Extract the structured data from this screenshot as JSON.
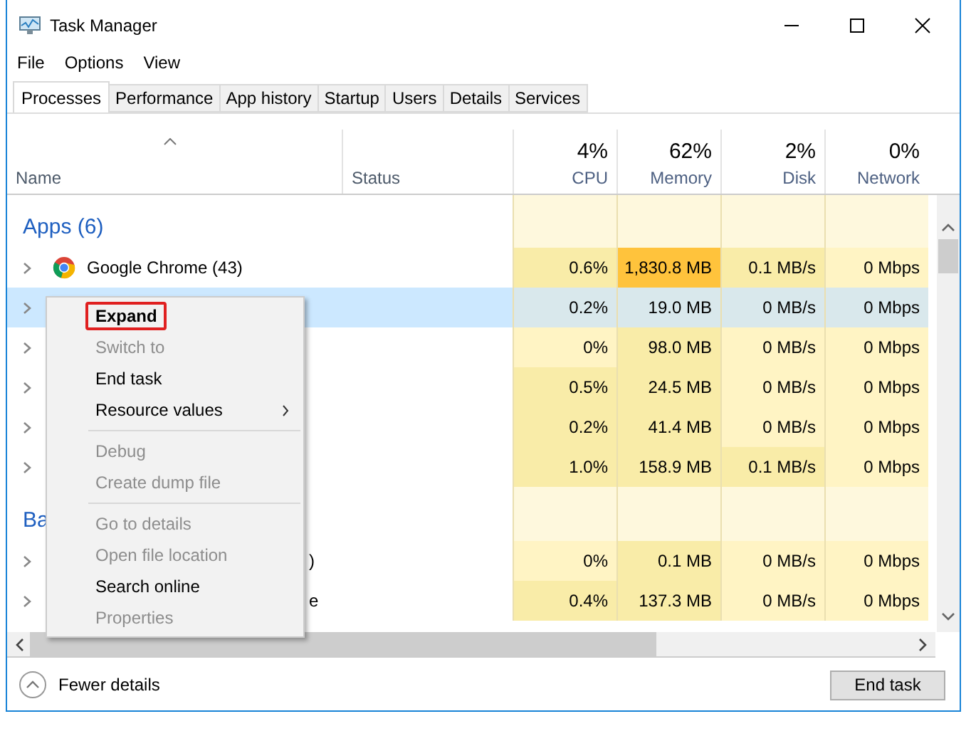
{
  "window": {
    "title": "Task Manager"
  },
  "menu": [
    "File",
    "Options",
    "View"
  ],
  "tabs": [
    {
      "label": "Processes",
      "selected": true
    },
    {
      "label": "Performance",
      "selected": false
    },
    {
      "label": "App history",
      "selected": false
    },
    {
      "label": "Startup",
      "selected": false
    },
    {
      "label": "Users",
      "selected": false
    },
    {
      "label": "Details",
      "selected": false
    },
    {
      "label": "Services",
      "selected": false
    }
  ],
  "columns": [
    {
      "label": "Name",
      "sorted": true
    },
    {
      "label": "Status"
    },
    {
      "label": "CPU",
      "total": "4%"
    },
    {
      "label": "Memory",
      "total": "62%"
    },
    {
      "label": "Disk",
      "total": "2%"
    },
    {
      "label": "Network",
      "total": "0%"
    }
  ],
  "rows": [
    {
      "kind": "group",
      "name": "Apps (6)"
    },
    {
      "kind": "browser",
      "name": "Google Chrome (43)",
      "selected": false,
      "cells": [
        {
          "text": "0.6%",
          "color": "#f9eca8"
        },
        {
          "text": "1,830.8 MB",
          "color": "#ffc33c"
        },
        {
          "text": "0.1 MB/s",
          "color": "#f9eca8"
        },
        {
          "text": "0 Mbps",
          "color": "#fff4c4"
        }
      ]
    },
    {
      "kind": "process",
      "selected": true,
      "cells": [
        {
          "text": "0.2%",
          "color": "#d9e8ec"
        },
        {
          "text": "19.0 MB",
          "color": "#d9e8ec"
        },
        {
          "text": "0 MB/s",
          "color": "#d9e8ec"
        },
        {
          "text": "0 Mbps",
          "color": "#d9e8ec"
        }
      ]
    },
    {
      "kind": "process",
      "selected": false,
      "cells": [
        {
          "text": "0%",
          "color": "#fff4c4"
        },
        {
          "text": "98.0 MB",
          "color": "#f9eca8"
        },
        {
          "text": "0 MB/s",
          "color": "#fff4c4"
        },
        {
          "text": "0 Mbps",
          "color": "#fff4c4"
        }
      ]
    },
    {
      "kind": "process",
      "selected": false,
      "cells": [
        {
          "text": "0.5%",
          "color": "#f9eca8"
        },
        {
          "text": "24.5 MB",
          "color": "#f9eca8"
        },
        {
          "text": "0 MB/s",
          "color": "#fff4c4"
        },
        {
          "text": "0 Mbps",
          "color": "#fff4c4"
        }
      ]
    },
    {
      "kind": "process",
      "selected": false,
      "cells": [
        {
          "text": "0.2%",
          "color": "#f9eca8"
        },
        {
          "text": "41.4 MB",
          "color": "#f9eca8"
        },
        {
          "text": "0 MB/s",
          "color": "#fff4c4"
        },
        {
          "text": "0 Mbps",
          "color": "#fff4c4"
        }
      ]
    },
    {
      "kind": "process",
      "selected": false,
      "cells": [
        {
          "text": "1.0%",
          "color": "#f9eca8"
        },
        {
          "text": "158.9 MB",
          "color": "#f9eca8"
        },
        {
          "text": "0.1 MB/s",
          "color": "#f9eca8"
        },
        {
          "text": "0 Mbps",
          "color": "#fff4c4"
        }
      ]
    },
    {
      "kind": "group",
      "name": "Ba"
    },
    {
      "kind": "covered",
      "name": ")",
      "selected": false,
      "cells": [
        {
          "text": "0%",
          "color": "#fff4c4"
        },
        {
          "text": "0.1 MB",
          "color": "#f9eca8"
        },
        {
          "text": "0 MB/s",
          "color": "#fff4c4"
        },
        {
          "text": "0 Mbps",
          "color": "#fff4c4"
        }
      ]
    },
    {
      "kind": "covered",
      "name": "e",
      "selected": false,
      "cells": [
        {
          "text": "0.4%",
          "color": "#f9eca8"
        },
        {
          "text": "137.3 MB",
          "color": "#f9eca8"
        },
        {
          "text": "0 MB/s",
          "color": "#fff4c4"
        },
        {
          "text": "0 Mbps",
          "color": "#fff4c4"
        }
      ]
    }
  ],
  "context_menu": [
    {
      "kind": "item",
      "label": "Expand",
      "disabled": false,
      "default": true,
      "highlighted": true
    },
    {
      "kind": "item",
      "label": "Switch to",
      "disabled": true
    },
    {
      "kind": "item",
      "label": "End task",
      "disabled": false
    },
    {
      "kind": "item",
      "label": "Resource values",
      "disabled": false,
      "submenu": true
    },
    {
      "kind": "separator"
    },
    {
      "kind": "item",
      "label": "Debug",
      "disabled": true
    },
    {
      "kind": "item",
      "label": "Create dump file",
      "disabled": true
    },
    {
      "kind": "separator"
    },
    {
      "kind": "item",
      "label": "Go to details",
      "disabled": true
    },
    {
      "kind": "item",
      "label": "Open file location",
      "disabled": true
    },
    {
      "kind": "item",
      "label": "Search online",
      "disabled": false
    },
    {
      "kind": "item",
      "label": "Properties",
      "disabled": true
    }
  ],
  "footer": {
    "toggle": "Fewer details",
    "button": "End task"
  }
}
